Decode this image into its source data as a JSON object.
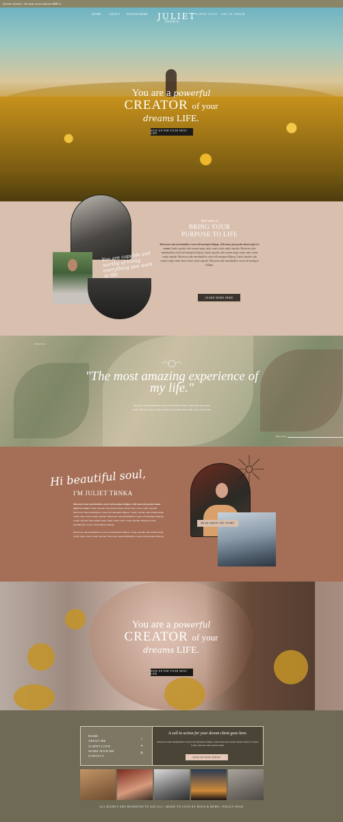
{
  "announcement": {
    "brand_script": "Dream Queen",
    "text": "Get early access and save $600"
  },
  "nav": {
    "items": [
      "HOME",
      "ABOUT",
      "PROGRAMME",
      "CLIENT LOVE",
      "GET IN TOUCH"
    ],
    "logo_line1": "JULIET",
    "logo_line2": "TRNKA"
  },
  "hero": {
    "line1_plain": "You are a",
    "line1_script": "powerful",
    "line2_caps": "CREATOR",
    "line2_small": "of your",
    "line3_script": "dreams",
    "line3_caps": "LIFE.",
    "button": "SIGN UP FOR YOUR NEXT LIFE"
  },
  "welcome": {
    "small": "Welcome to",
    "heading_line1": "BRING YOUR",
    "heading_line2": "PURPOSE TO LIFE",
    "body_bold": "Macaroon cake marshmallow sweet roll marzipan lollipop. Jelly beans pie powder donut wafer ice cream.",
    "body": "Candy cupcake cake sesame snaps candy canes cotton candy cupcake. Macaroon cake marshmallow sweet roll marzipan lollipop. Candy cupcake cake sesame snaps candy canes cotton candy cupcake. Macaroon cake marshmallow sweet roll marzipan lollipop. Candy cupcake cake sesame snaps candy canes cotton candy cupcake. Macaroon cake marshmallow sweet roll marzipan lollipop.",
    "overlay_script": "You are capable and worthy of living everything you want in life",
    "button": "LEARN MORE HERE"
  },
  "quote": {
    "label_tl": "Client Love",
    "label_br": "Read more",
    "text": "\"The most amazing experience of my life.\"",
    "sub": "Macaroon cake marshmallow sweet roll marzipan lollipop. Jelly beans pie powder donut wafer ice cream. Candy cupcake cake sesame snaps candy canes cotton candy."
  },
  "about": {
    "hi_script": "Hi beautiful soul,",
    "im": "I'M JULIET TRNKA",
    "para1_bold": "Macaroon cake marshmallow sweet roll marzipan lollipop. Jelly beans pie powder donut wafer ice cream.",
    "para1": "Candy cupcake cake sesame snaps candy canes cotton candy cupcake. Macaroon cake marshmallow sweet roll marzipan lollipop. Candy cupcake cake sesame snaps candy canes cotton candy cupcake. Macaroon cake marshmallow sweet roll marzipan lollipop. Candy cupcake cake sesame snaps candy canes cotton candy cupcake. Macaroon cake marshmallow sweet roll marzipan lollipop.",
    "para2": "Macaroon cake marshmallow sweet roll marzipan lollipop. Candy cupcake cake sesame snaps candy canes cotton candy cupcake. Macaroon cake marshmallow sweet roll marzipan lollipop.",
    "button": "READ ABOUT MY STORY"
  },
  "hero2": {
    "line1_plain": "You are a",
    "line1_script": "powerful",
    "line2_caps": "CREATOR",
    "line2_small": "of your",
    "line3_script": "dreams",
    "line3_caps": "LIFE.",
    "button": "SIGN UP FOR YOUR NEXT LIFE"
  },
  "footer": {
    "menu": [
      "HOME",
      "ABOUT ME",
      "CLIENT LOVE",
      "WORK WITH ME",
      "CONTACT"
    ],
    "social_icons": [
      "facebook-icon",
      "twitter-icon",
      "instagram-icon"
    ],
    "cta_heading": "A call to action for your dream client goes here.",
    "cta_body": "Macaroon cake marshmallow sweet roll marzipan lollipop. Jelly beans pie powder donut wafer ice cream. Candy cupcake cake sesame snaps.",
    "cta_button": "SIGN UP NOW TODAY",
    "copyright": "ALL RIGHTS ARE RESERVED TO GIO LLC",
    "made_by": "MADE TO LOVE BY BOLD & BOHO",
    "policy": "POLICY PAGE"
  },
  "colors": {
    "tan": "#d8bfae",
    "terracotta": "#a46f56",
    "olive": "#6f6a55",
    "dark": "#1c1a17"
  }
}
